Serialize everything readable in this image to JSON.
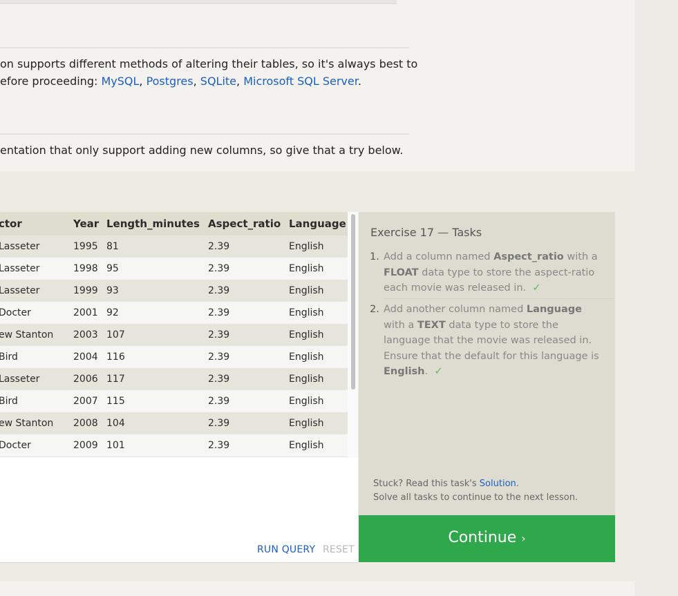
{
  "lesson": {
    "para1_line1": "on supports different methods of altering their tables, so it's always best to",
    "para1_line2_prefix": "efore proceeding: ",
    "links": [
      "MySQL",
      "Postgres",
      "SQLite",
      "Microsoft SQL Server"
    ],
    "para2": "entation that only support adding new columns, so give that a try below."
  },
  "results": {
    "columns": [
      "ctor",
      "Year",
      "Length_minutes",
      "Aspect_ratio",
      "Language"
    ],
    "rows": [
      [
        "Lasseter",
        "1995",
        "81",
        "2.39",
        "English"
      ],
      [
        "Lasseter",
        "1998",
        "95",
        "2.39",
        "English"
      ],
      [
        "Lasseter",
        "1999",
        "93",
        "2.39",
        "English"
      ],
      [
        "Docter",
        "2001",
        "92",
        "2.39",
        "English"
      ],
      [
        "ew Stanton",
        "2003",
        "107",
        "2.39",
        "English"
      ],
      [
        "Bird",
        "2004",
        "116",
        "2.39",
        "English"
      ],
      [
        "Lasseter",
        "2006",
        "117",
        "2.39",
        "English"
      ],
      [
        "Bird",
        "2007",
        "115",
        "2.39",
        "English"
      ],
      [
        "ew Stanton",
        "2008",
        "104",
        "2.39",
        "English"
      ],
      [
        "Docter",
        "2009",
        "101",
        "2.39",
        "English"
      ]
    ]
  },
  "editor": {
    "run_label": "RUN QUERY",
    "reset_label": "RESET"
  },
  "tasks": {
    "title_prefix": "Exercise 17",
    "title_sep": " — ",
    "title_suffix": "Tasks",
    "items": [
      {
        "num": "1.",
        "check": "✓"
      },
      {
        "num": "2.",
        "check": "✓"
      }
    ],
    "stuck_prefix": "Stuck? Read this task's ",
    "solution_link": "Solution",
    "stuck_suffix": ".",
    "solve_all": "Solve all tasks to continue to the next lesson."
  },
  "continue": {
    "label": "Continue",
    "arrow": "›"
  },
  "colors": {
    "link": "#1b5fc1",
    "continue_bg": "#2fa84b",
    "check": "#5cb85c"
  }
}
